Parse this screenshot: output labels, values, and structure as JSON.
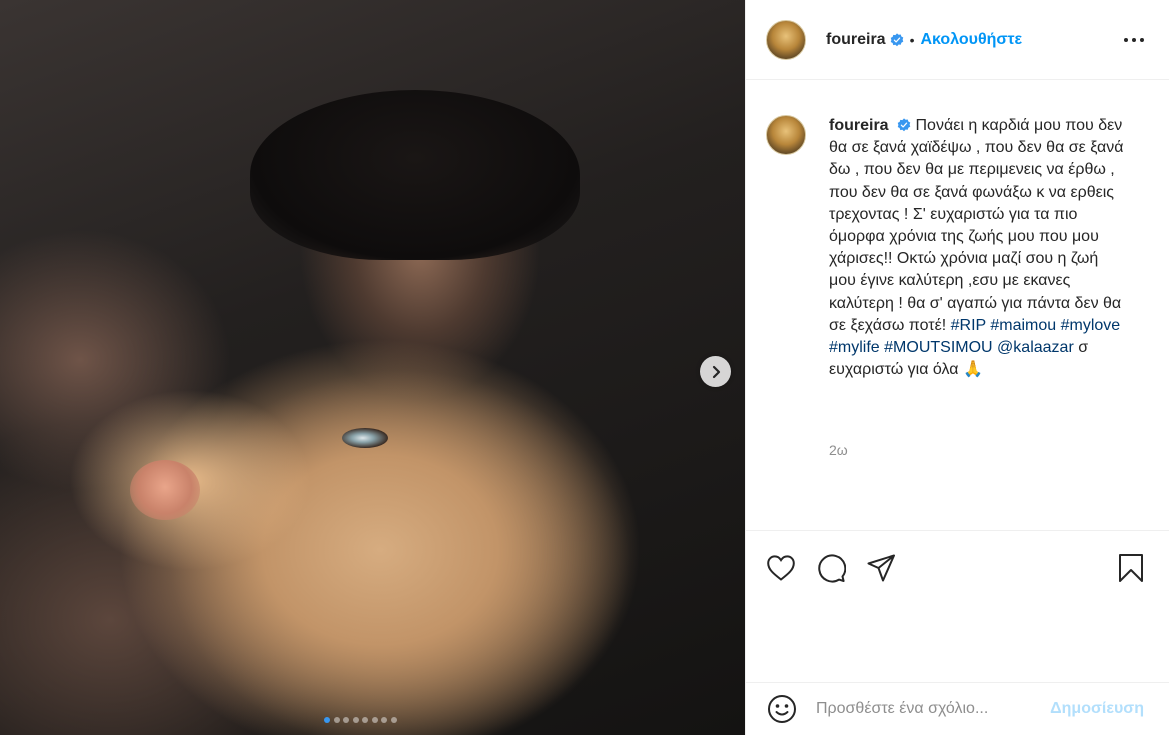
{
  "post": {
    "image_alt": "photo of a woman kissing a shar-pei dog",
    "carousel": {
      "total": 8,
      "active": 0
    }
  },
  "header": {
    "username": "foureira",
    "separator": "•",
    "follow_label": "Ακολουθήστε"
  },
  "caption": {
    "username": "foureira",
    "text": "Πονάει η καρδιά μου που δεν θα σε ξανά χαϊδέψω , που δεν θα σε ξανά δω , που δεν θα με περιμενεις να έρθω , που δεν θα σε ξανά φωνάξω κ να ερθεις τρεχοντας ! Σ' ευχαριστώ για τα πιο όμορφα χρόνια της ζωής μου που μου χάρισες!! Οκτώ χρόνια μαζί σου η ζωή μου έγινε καλύτερη ,εσυ με εκανες καλύτερη ! θα σ' αγαπώ για πάντα δεν θα σε ξεχάσω ποτέ!",
    "tags": [
      "#RIP",
      "#maimou",
      "#mylove",
      "#mylife",
      "#MOUTSIMOU",
      "@kalaazar"
    ],
    "tail": "σ ευχαριστώ για όλα",
    "emoji": "🙏",
    "time": "2ω"
  },
  "comment": {
    "placeholder": "Προσθέστε ένα σχόλιο...",
    "post_label": "Δημοσίευση"
  },
  "colors": {
    "link": "#0095f6",
    "hashtag": "#00376b",
    "muted": "#8e8e8e",
    "post_disabled": "#b2dffc"
  },
  "icons": {
    "verified": "verified-badge-icon",
    "like": "heart-icon",
    "comment": "comment-bubble-icon",
    "share": "paper-plane-icon",
    "save": "bookmark-icon",
    "emoji": "smiley-icon",
    "next": "chevron-right-icon",
    "more": "more-dots-icon"
  }
}
